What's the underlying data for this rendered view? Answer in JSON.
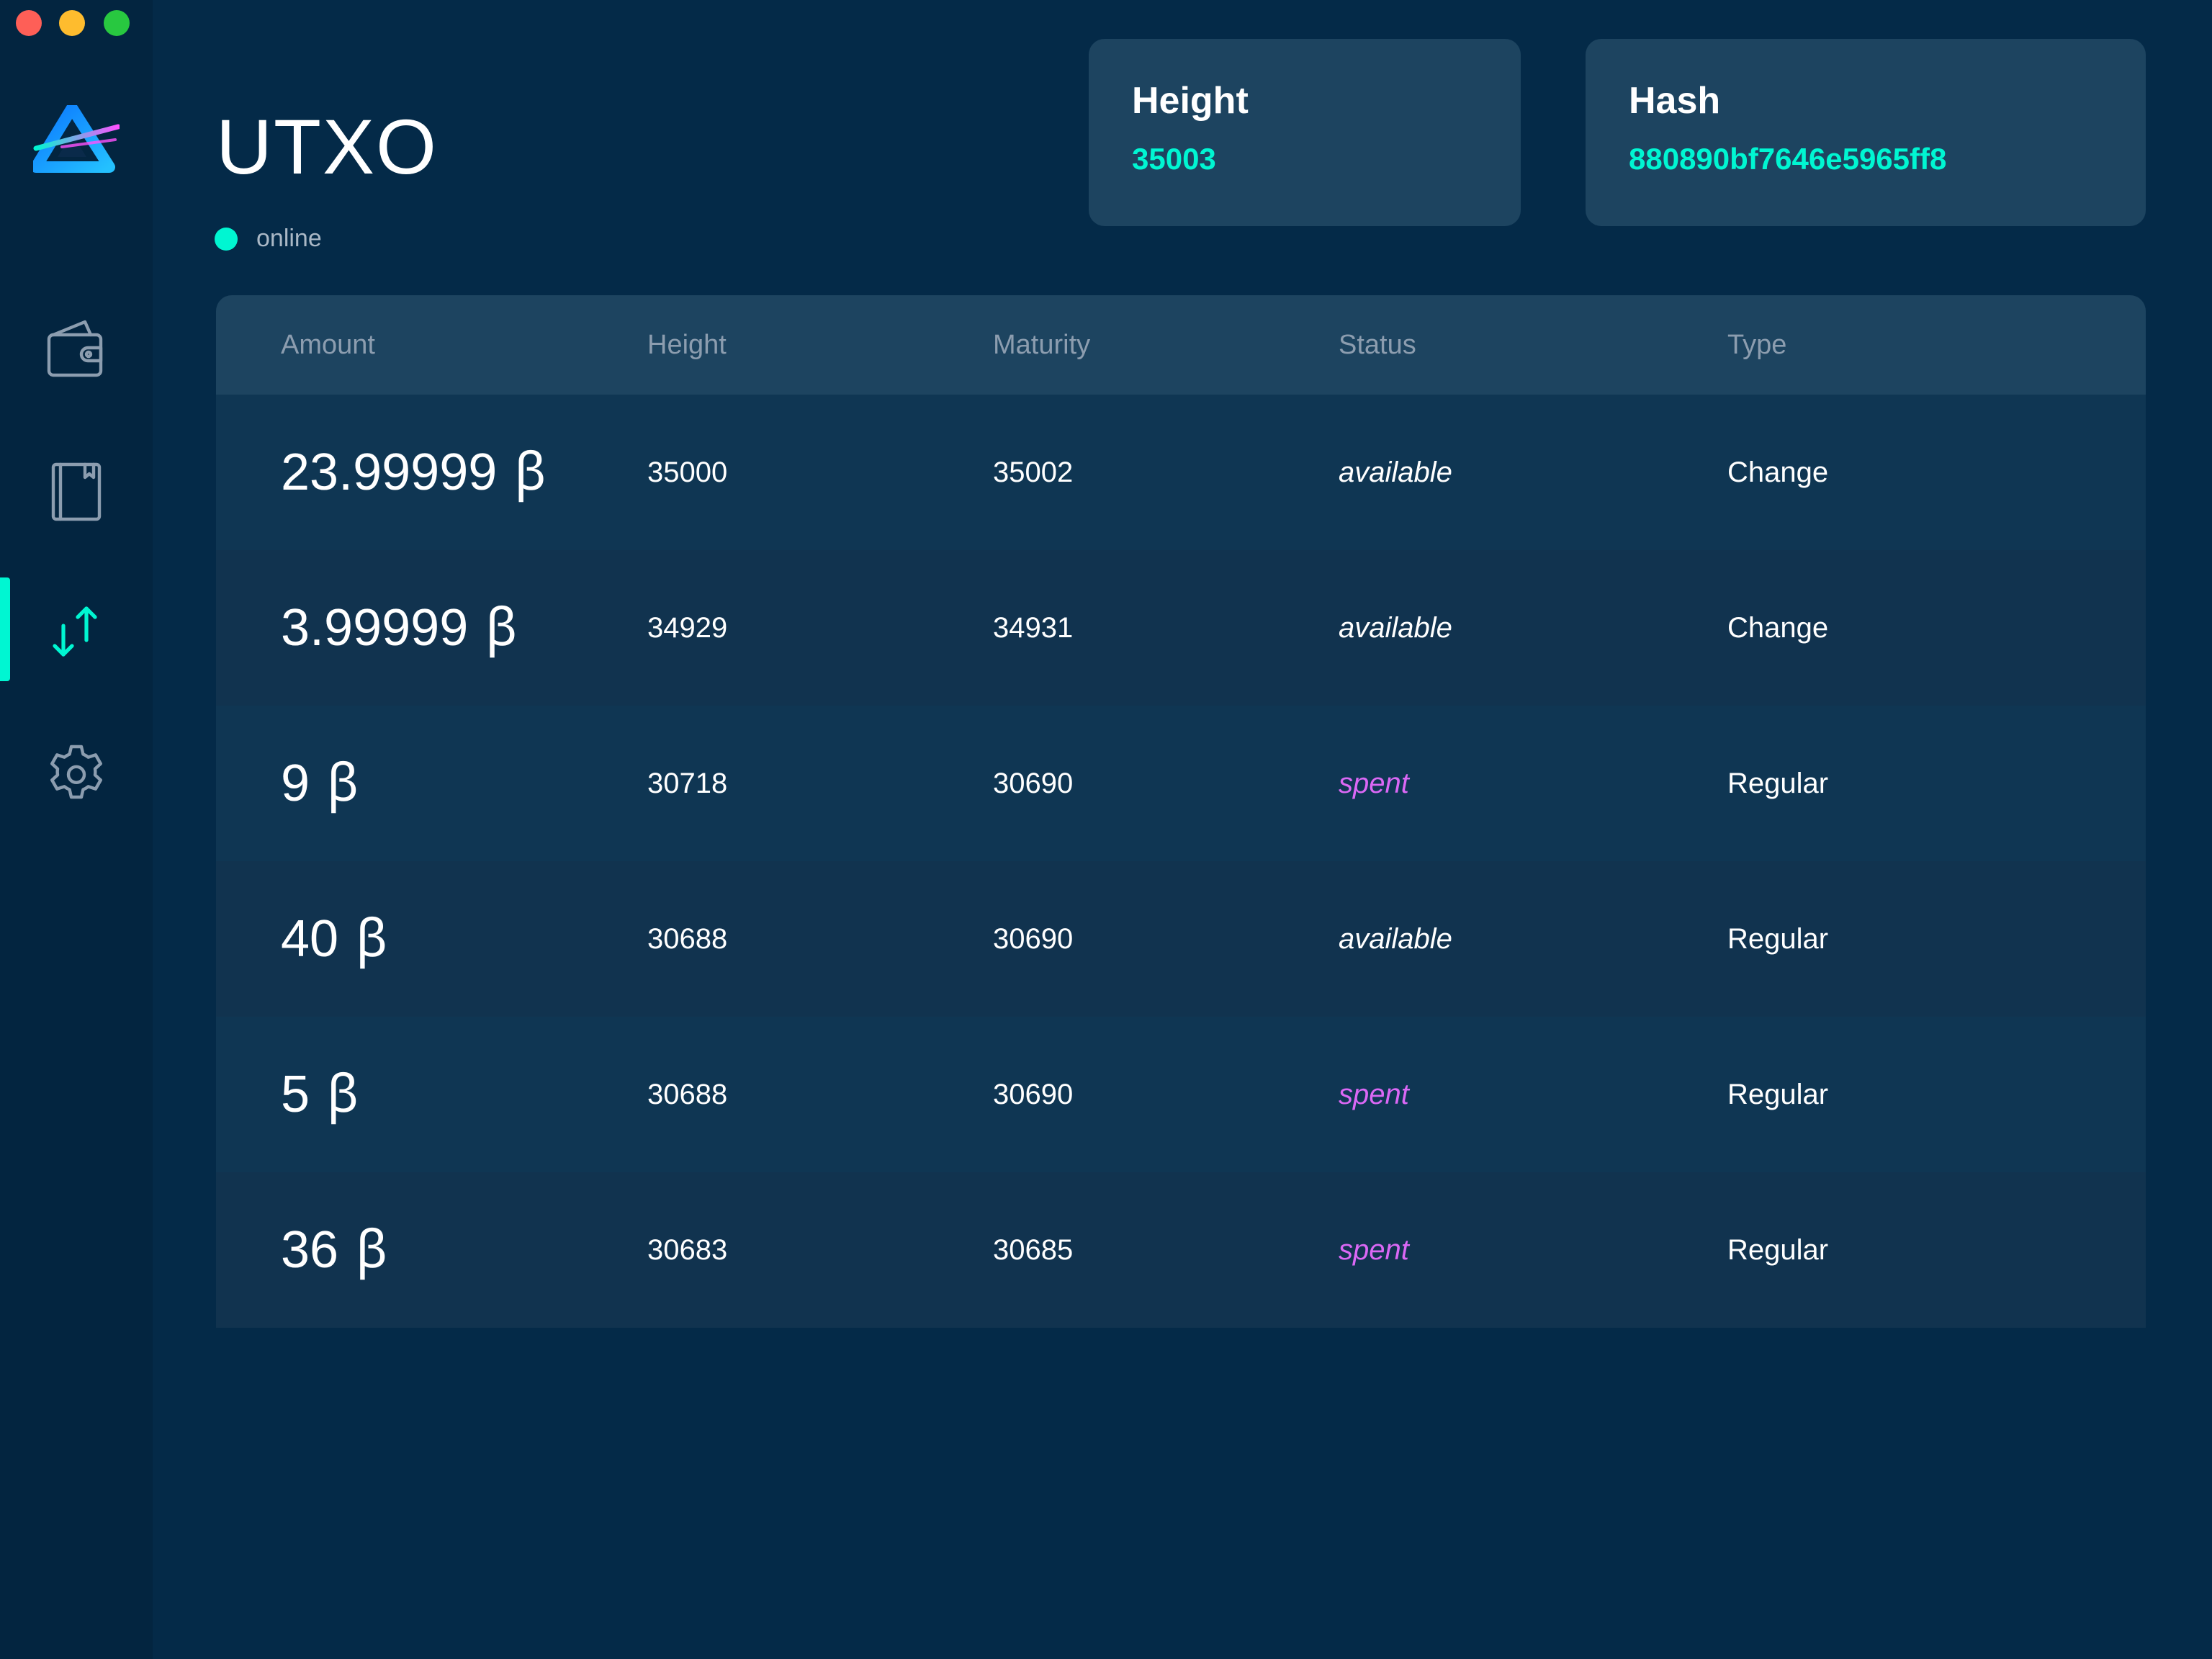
{
  "window": {
    "controls": [
      "close",
      "minimize",
      "zoom"
    ]
  },
  "sidebar": {
    "logo_icon": "beam-logo",
    "items": [
      {
        "icon": "wallet-icon",
        "active": false
      },
      {
        "icon": "notebook-icon",
        "active": false
      },
      {
        "icon": "arrows-updown-icon",
        "active": true
      },
      {
        "icon": "gear-icon",
        "active": false
      }
    ]
  },
  "header": {
    "title": "UTXO",
    "status": "online"
  },
  "cards": {
    "height": {
      "label": "Height",
      "value": "35003"
    },
    "hash": {
      "label": "Hash",
      "value": "880890bf7646e5965ff8"
    }
  },
  "table": {
    "columns": [
      "Amount",
      "Height",
      "Maturity",
      "Status",
      "Type"
    ],
    "currency_symbol": "ꞵ",
    "rows": [
      {
        "amount": "23.99999",
        "height": "35000",
        "maturity": "35002",
        "status": "available",
        "type": "Change"
      },
      {
        "amount": "3.99999",
        "height": "34929",
        "maturity": "34931",
        "status": "available",
        "type": "Change"
      },
      {
        "amount": "9",
        "height": "30718",
        "maturity": "30690",
        "status": "spent",
        "type": "Regular"
      },
      {
        "amount": "40",
        "height": "30688",
        "maturity": "30690",
        "status": "available",
        "type": "Regular"
      },
      {
        "amount": "5",
        "height": "30688",
        "maturity": "30690",
        "status": "spent",
        "type": "Regular"
      },
      {
        "amount": "36",
        "height": "30683",
        "maturity": "30685",
        "status": "spent",
        "type": "Regular"
      }
    ]
  },
  "colors": {
    "background": "#042a48",
    "sidebar": "#032540",
    "card": "#1d4460",
    "accent": "#00f6d2",
    "spent": "#da68f5"
  }
}
